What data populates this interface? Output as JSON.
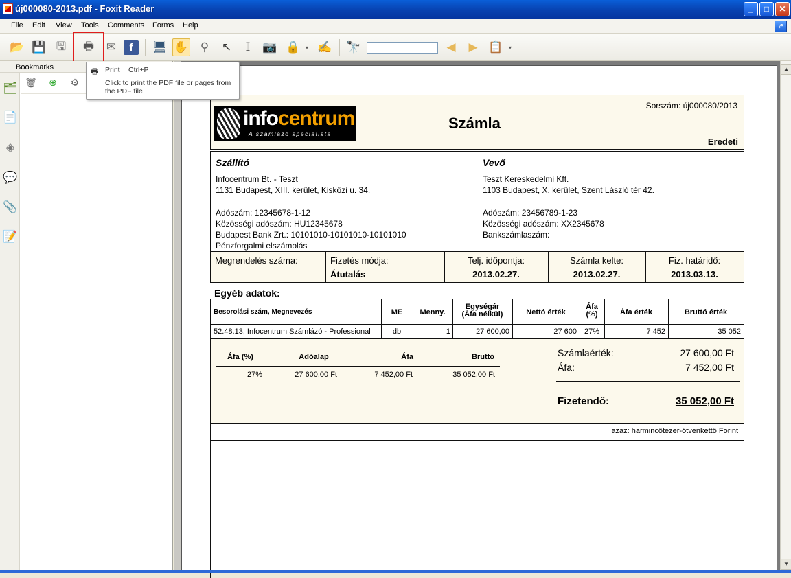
{
  "window": {
    "title": "új000080-2013.pdf - Foxit Reader",
    "min": "_",
    "max": "□",
    "close": "✕"
  },
  "menu": [
    "File",
    "Edit",
    "View",
    "Tools",
    "Comments",
    "Forms",
    "Help"
  ],
  "sidebar": {
    "title": "Bookmarks"
  },
  "tooltip": {
    "name": "Print",
    "shortcut": "Ctrl+P",
    "description": "Click to print the PDF file or pages from the PDF file"
  },
  "invoice": {
    "serial": "Sorszám: új000080/2013",
    "title": "Számla",
    "copy": "Eredeti",
    "logo_text_a": "info",
    "logo_text_b": "centrum",
    "logo_slogan": "A számlázó specialista",
    "supplier": {
      "heading": "Szállító",
      "name": "Infocentrum Bt. - Teszt",
      "address": "1131 Budapest, XIII. kerület, Kisközi u. 34.",
      "tax": "Adószám: 12345678-1-12",
      "eu_tax": "Közösségi adószám: HU12345678",
      "bank": "Budapest Bank Zrt.:  10101010-10101010-10101010",
      "note": "Pénzforgalmi elszámolás"
    },
    "buyer": {
      "heading": "Vevő",
      "name": "Teszt Kereskedelmi Kft.",
      "address": "1103 Budapest, X. kerület, Szent László tér 42.",
      "tax": "Adószám: 23456789-1-23",
      "eu_tax": "Közösségi adószám: XX2345678",
      "bank": "Bankszámlaszám:"
    },
    "meta": {
      "order_label": "Megrendelés száma:",
      "payment_label": "Fizetés módja:",
      "payment_value": "Átutalás",
      "perf_label": "Telj. időpontja:",
      "perf_value": "2013.02.27.",
      "issue_label": "Számla kelte:",
      "issue_value": "2013.02.27.",
      "due_label": "Fiz. határidő:",
      "due_value": "2013.03.13."
    },
    "other_data": "Egyéb adatok:",
    "items_header": {
      "desc": "Besorolási szám, Megnevezés",
      "unit": "ME",
      "qty": "Menny.",
      "unit_price_1": "Egységár",
      "unit_price_2": "(Áfa nélkül)",
      "net": "Nettó érték",
      "vat_pct_1": "Áfa",
      "vat_pct_2": "(%)",
      "vat": "Áfa érték",
      "gross": "Bruttó érték"
    },
    "item": {
      "desc": "52.48.13, Infocentrum Számlázó - Professional",
      "unit": "db",
      "qty": "1",
      "unit_price": "27 600,00",
      "net": "27 600",
      "vat_pct": "27%",
      "vat": "7 452",
      "gross": "35 052"
    },
    "vat_summary": {
      "h_rate": "Áfa (%)",
      "h_base": "Adóalap",
      "h_vat": "Áfa",
      "h_gross": "Bruttó",
      "rate": "27%",
      "base": "27 600,00 Ft",
      "vat": "7 452,00 Ft",
      "gross": "35 052,00 Ft"
    },
    "totals": {
      "net_label": "Számlaérték:",
      "net_value": "27 600,00 Ft",
      "vat_label": "Áfa:",
      "vat_value": "7 452,00 Ft",
      "pay_label": "Fizetendő:",
      "pay_value": "35 052,00 Ft"
    },
    "in_words": "azaz:  harmincötezer-ötvenkettő Forint"
  }
}
